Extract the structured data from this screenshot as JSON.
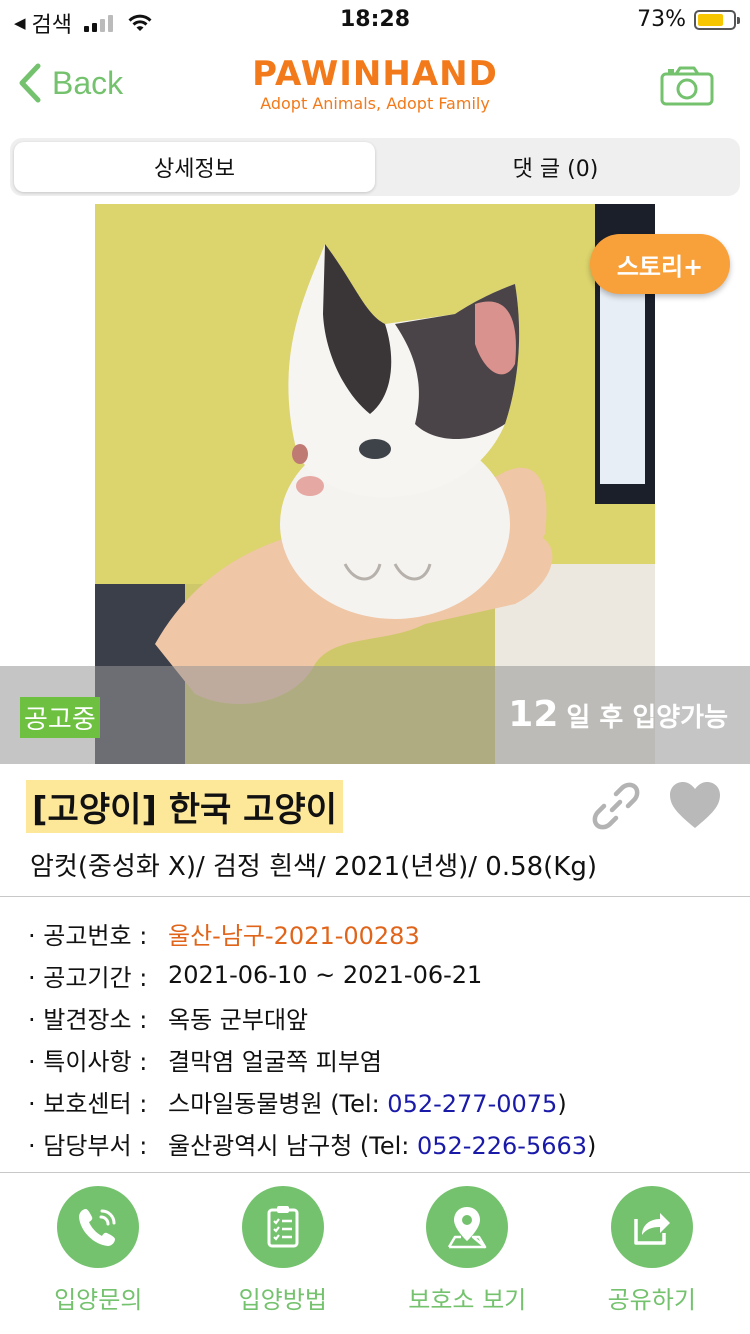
{
  "status_bar": {
    "back_app": "검색",
    "time": "18:28",
    "battery_percent": "73%",
    "battery_level": 0.73
  },
  "nav": {
    "back_label": "Back",
    "logo_title": "PAWINHAND",
    "logo_subtitle": "Adopt Animals, Adopt Family",
    "camera_icon": "camera-icon"
  },
  "tabs": [
    {
      "label": "상세정보",
      "active": true
    },
    {
      "label": "댓 글 (0)",
      "active": false
    }
  ],
  "photo": {
    "story_button": "스토리+",
    "status_chip": "공고중",
    "days": "12",
    "days_suffix": "일 후 입양가능"
  },
  "animal": {
    "title": "[고양이] 한국 고양이",
    "subtitle": "암컷(중성화 X)/ 검정 흰색/ 2021(년생)/ 0.58(Kg)"
  },
  "details": {
    "notice_no": {
      "label": "· 공고번호 :",
      "value": "울산-남구-2021-00283"
    },
    "period": {
      "label": "· 공고기간 :",
      "value": "2021-06-10 ~ 2021-06-21"
    },
    "found_place": {
      "label": "· 발견장소 :",
      "value": "옥동 군부대앞"
    },
    "notes": {
      "label": "· 특이사항 :",
      "value": "결막염 얼굴쪽 피부염"
    },
    "shelter": {
      "label": "· 보호센터 :",
      "value": "스마일동물병원 (Tel: ",
      "tel": "052-277-0075",
      "close": ")"
    },
    "office": {
      "label": "· 담당부서 :",
      "value": "울산광역시 남구청 (Tel: ",
      "tel": "052-226-5663",
      "close": ")"
    }
  },
  "actions": [
    {
      "label": "입양문의",
      "icon": "phone-icon"
    },
    {
      "label": "입양방법",
      "icon": "clipboard-icon"
    },
    {
      "label": "보호소 보기",
      "icon": "map-pin-icon"
    },
    {
      "label": "공유하기",
      "icon": "share-icon"
    }
  ],
  "colors": {
    "accent_green": "#74c26e",
    "logo_orange": "#f27a1a",
    "story_orange": "#f8a03a",
    "title_highlight": "#fde89a",
    "tel_blue": "#1a1aa8"
  }
}
